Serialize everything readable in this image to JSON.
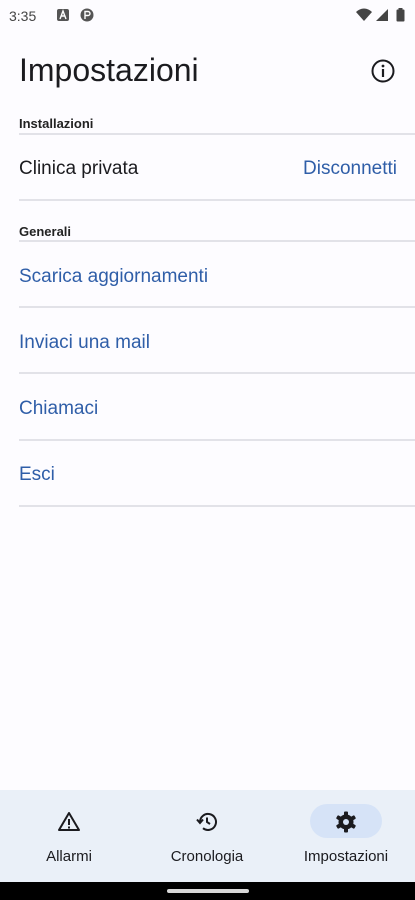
{
  "status_bar": {
    "time": "3:35"
  },
  "header": {
    "title": "Impostazioni"
  },
  "sections": {
    "installazioni": {
      "header": "Installazioni",
      "clinic_name": "Clinica privata",
      "disconnect_label": "Disconnetti"
    },
    "generali": {
      "header": "Generali",
      "items": [
        {
          "label": "Scarica aggiornamenti"
        },
        {
          "label": "Inviaci una mail"
        },
        {
          "label": "Chiamaci"
        },
        {
          "label": "Esci"
        }
      ]
    }
  },
  "bottom_nav": {
    "items": [
      {
        "label": "Allarmi",
        "icon": "warning-icon"
      },
      {
        "label": "Cronologia",
        "icon": "history-icon"
      },
      {
        "label": "Impostazioni",
        "icon": "gear-icon",
        "active": true
      }
    ]
  },
  "colors": {
    "link": "#2f5ea8",
    "nav_bg": "#eaf0f8",
    "nav_active": "#d6e3f7"
  }
}
